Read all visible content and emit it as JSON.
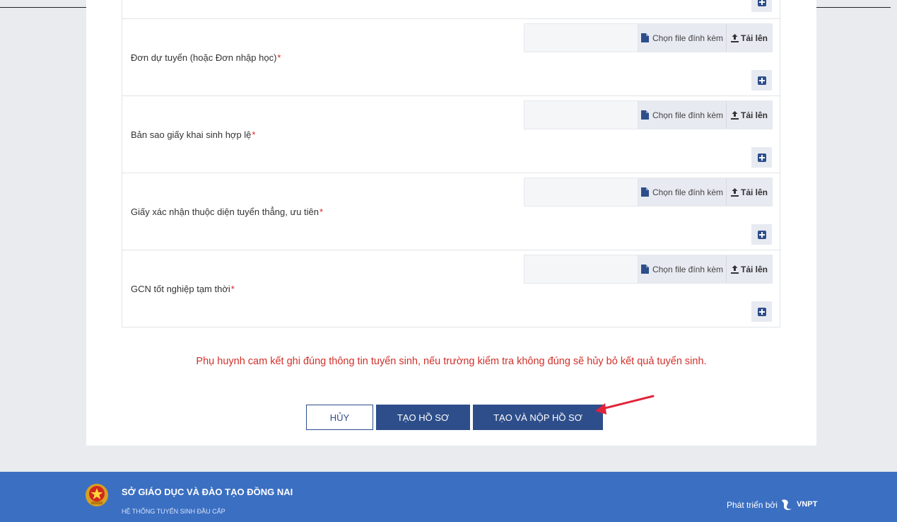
{
  "documents": [
    {
      "label": "Đơn dự tuyển (hoặc Đơn nhập học)",
      "required_mark": "*"
    },
    {
      "label": "Bản sao giấy khai sinh hợp lệ",
      "required_mark": "*"
    },
    {
      "label": "Giấy xác nhận thuộc diện tuyển thẳng, ưu tiên",
      "required_mark": "*"
    },
    {
      "label": "GCN tốt nghiệp tạm thời",
      "required_mark": "*"
    }
  ],
  "upload": {
    "choose_label": "Chọn file đính kèm",
    "upload_label": "Tải lên"
  },
  "notice": "Phụ huynh cam kết ghi đúng thông tin tuyển sinh, nếu trường kiểm tra không đúng sẽ hủy bỏ kết quả tuyển sinh.",
  "actions": {
    "cancel": "HỦY",
    "create": "TẠO HỒ SƠ",
    "create_submit": "TẠO VÀ NỘP HỒ SƠ"
  },
  "footer": {
    "org_name": "SỞ GIÁO DỤC VÀ ĐÀO TẠO ĐỒNG NAI",
    "org_sub": "HỆ THỐNG TUYỂN SINH ĐẦU CẤP",
    "developed_by": "Phát triển bởi",
    "vendor": "VNPT"
  },
  "colors": {
    "primary": "#2d4e8a",
    "footer": "#3b6fc2",
    "required": "#e02020",
    "notice": "#d0302a",
    "annotation": "#e0243a"
  }
}
